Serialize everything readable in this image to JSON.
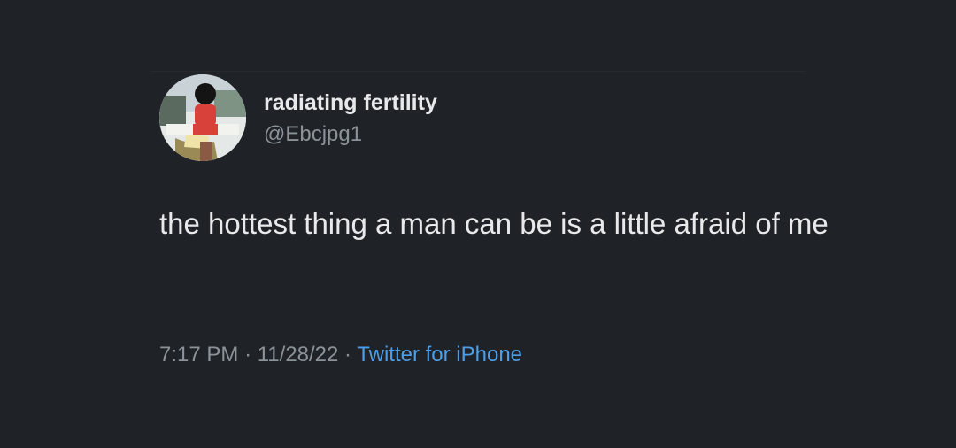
{
  "tweet": {
    "display_name": "radiating fertility",
    "handle": "@Ebcjpg1",
    "text": "the hottest thing a man can be is a little afraid of me",
    "time": "7:17 PM",
    "separator": "·",
    "date": "11/28/22",
    "source": "Twitter for iPhone"
  },
  "colors": {
    "background": "#1f2226",
    "primary_text": "#e7e9ea",
    "secondary_text": "#8b9399",
    "link": "#4d9ee8"
  }
}
